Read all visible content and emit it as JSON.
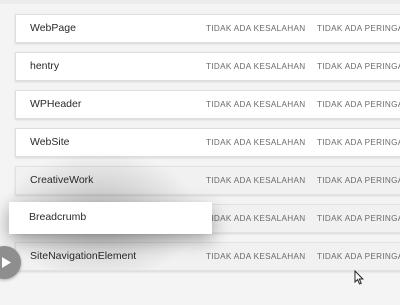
{
  "rows": [
    {
      "name": "WebPage",
      "status1": "TIDAK ADA KESALAHAN",
      "status2": "TIDAK ADA PERINGATAN"
    },
    {
      "name": "hentry",
      "status1": "TIDAK ADA KESALAHAN",
      "status2": "TIDAK ADA PERINGATAN"
    },
    {
      "name": "WPHeader",
      "status1": "TIDAK ADA KESALAHAN",
      "status2": "TIDAK ADA PERINGATAN"
    },
    {
      "name": "WebSite",
      "status1": "TIDAK ADA KESALAHAN",
      "status2": "TIDAK ADA PERINGATAN"
    },
    {
      "name": "CreativeWork",
      "status1": "TIDAK ADA KESALAHAN",
      "status2": "TIDAK ADA PERINGATAN"
    },
    {
      "name": "",
      "status1": "TIDAK ADA KESALAHAN",
      "status2": "TIDAK ADA PERINGATAN"
    },
    {
      "name": "SiteNavigationElement",
      "status1": "TIDAK ADA KESALAHAN",
      "status2": "TIDAK ADA PERINGATAN"
    }
  ],
  "dragged_item": {
    "name": "Breadcrumb"
  },
  "icons": {
    "play": "play-icon",
    "cursor": "mouse-cursor-icon"
  },
  "colors": {
    "row_background": "#ffffff",
    "status_text": "#6b6b6b",
    "play_button": "#8e8e8e"
  }
}
